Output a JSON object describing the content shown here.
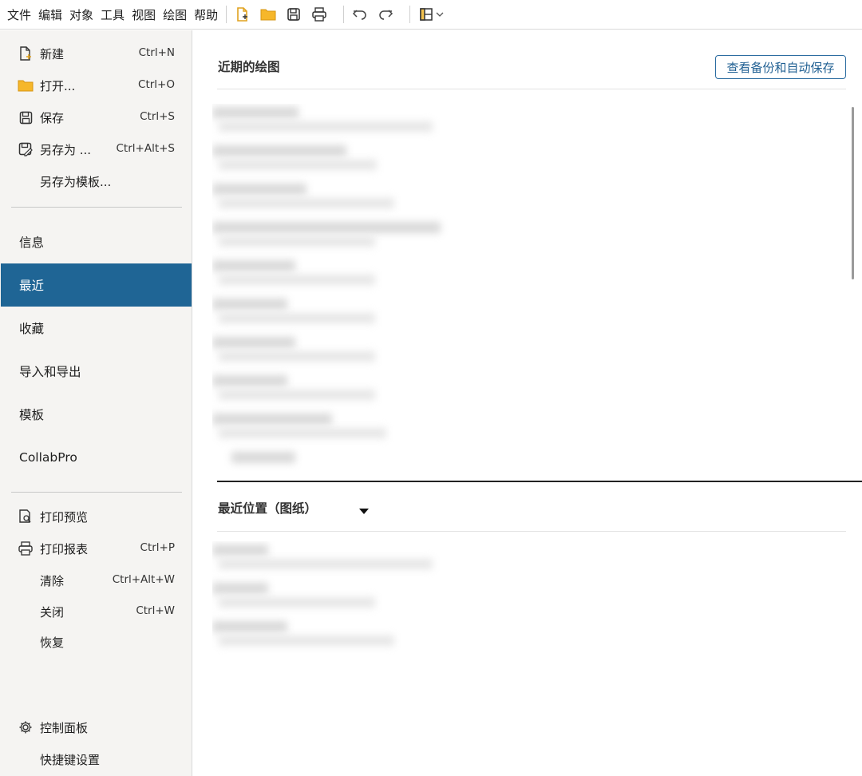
{
  "menubar": {
    "items": [
      "文件",
      "编辑",
      "对象",
      "工具",
      "视图",
      "绘图",
      "帮助"
    ],
    "toolbar_icons": [
      "new-file-icon",
      "open-folder-icon",
      "save-icon",
      "print-icon",
      "undo-icon",
      "redo-icon",
      "layout-icon",
      "chevron-down-icon"
    ]
  },
  "sidebar": {
    "commands": [
      {
        "label": "新建",
        "shortcut": "Ctrl+N",
        "icon": "new-file-icon"
      },
      {
        "label": "打开...",
        "shortcut": "Ctrl+O",
        "icon": "open-folder-icon"
      },
      {
        "label": "保存",
        "shortcut": "Ctrl+S",
        "icon": "save-icon"
      },
      {
        "label": "另存为 ...",
        "shortcut": "Ctrl+Alt+S",
        "icon": "save-as-icon"
      },
      {
        "label": "另存为模板...",
        "shortcut": "",
        "icon": ""
      }
    ],
    "nav": [
      "信息",
      "最近",
      "收藏",
      "导入和导出",
      "模板",
      "CollabPro"
    ],
    "active_nav": "最近",
    "print_commands": [
      {
        "label": "打印预览",
        "shortcut": "",
        "icon": "print-preview-icon"
      },
      {
        "label": "打印报表",
        "shortcut": "Ctrl+P",
        "icon": "print-icon"
      },
      {
        "label": "清除",
        "shortcut": "Ctrl+Alt+W",
        "icon": ""
      },
      {
        "label": "关闭",
        "shortcut": "Ctrl+W",
        "icon": ""
      },
      {
        "label": "恢复",
        "shortcut": "",
        "icon": ""
      }
    ],
    "bottom": [
      {
        "label": "控制面板",
        "icon": "gear-icon"
      },
      {
        "label": "快捷键设置",
        "icon": ""
      }
    ],
    "accent_color": "#1f6595"
  },
  "main": {
    "recent_title": "近期的绘图",
    "backup_button": "查看备份和自动保存",
    "locations_title": "最近位置（图纸）"
  }
}
